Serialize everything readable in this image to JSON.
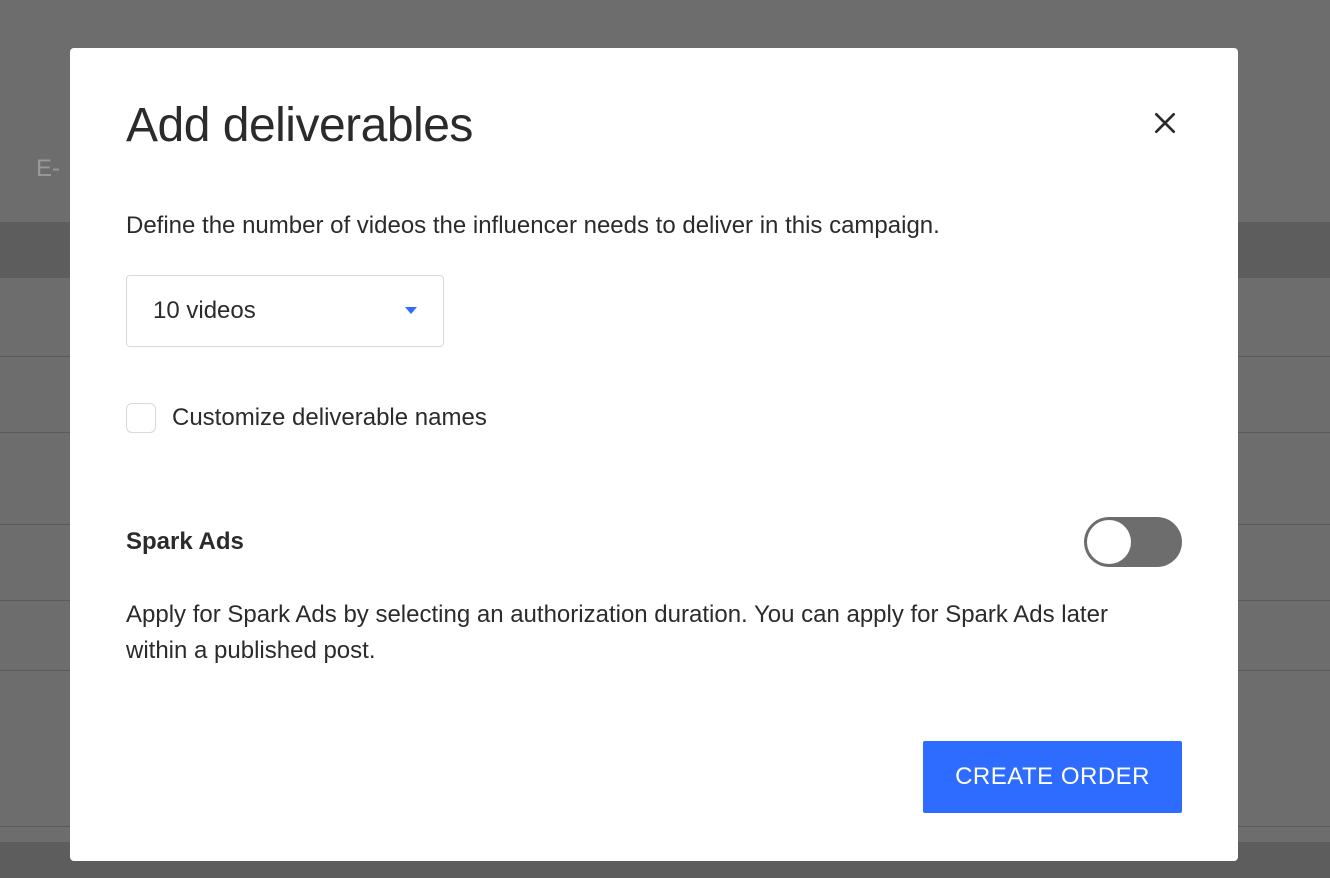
{
  "backdrop": {
    "partial_text": "E-"
  },
  "modal": {
    "title": "Add deliverables",
    "description": "Define the number of videos the influencer needs to deliver in this campaign.",
    "video_count_select": {
      "value": "10 videos"
    },
    "customize_checkbox": {
      "label": "Customize deliverable names",
      "checked": false
    },
    "spark_ads": {
      "title": "Spark Ads",
      "description": "Apply for Spark Ads by selecting an authorization duration. You can apply for Spark Ads later within a published post.",
      "enabled": false
    },
    "create_button_label": "CREATE ORDER"
  }
}
